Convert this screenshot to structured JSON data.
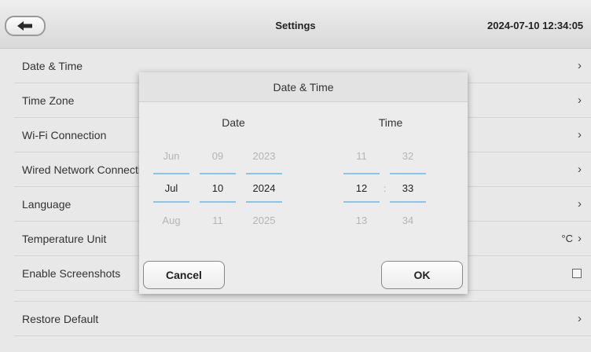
{
  "topbar": {
    "title": "Settings",
    "clock": "2024-07-10 12:34:05"
  },
  "settings": {
    "items": [
      {
        "label": "Date & Time",
        "value": ""
      },
      {
        "label": "Time Zone",
        "value": ""
      },
      {
        "label": "Wi-Fi Connection",
        "value": ""
      },
      {
        "label": "Wired Network Connection",
        "value": ""
      },
      {
        "label": "Language",
        "value": ""
      },
      {
        "label": "Temperature Unit",
        "value": "°C"
      },
      {
        "label": "Enable Screenshots",
        "value": ""
      },
      {
        "label": "Restore Default",
        "value": ""
      }
    ],
    "screenshots_enabled": false
  },
  "dialog": {
    "title": "Date & Time",
    "date_label": "Date",
    "time_label": "Time",
    "month": [
      "Jun",
      "Jul",
      "Aug"
    ],
    "day": [
      "09",
      "10",
      "11"
    ],
    "year": [
      "2023",
      "2024",
      "2025"
    ],
    "hour": [
      "11",
      "12",
      "13"
    ],
    "minute": [
      "32",
      "33",
      "34"
    ],
    "separator": ":",
    "cancel": "Cancel",
    "ok": "OK"
  },
  "colors": {
    "accent": "#86c6ea"
  }
}
